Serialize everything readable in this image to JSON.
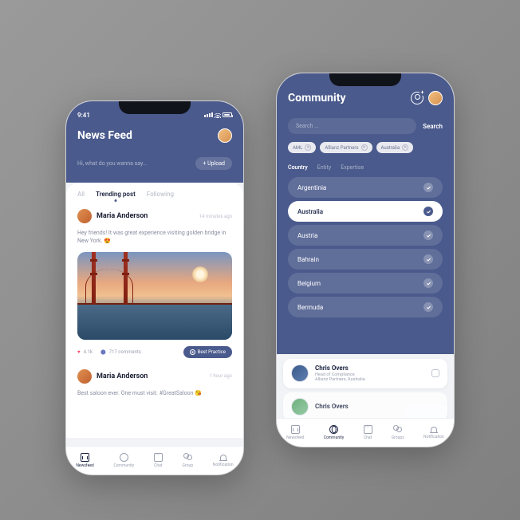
{
  "phone1": {
    "status_time": "9:41",
    "title": "News Feed",
    "say_placeholder": "Hi, what do you wanna say...",
    "upload_label": "+ Upload",
    "tabs": [
      "All",
      "Trending post",
      "Following"
    ],
    "post1": {
      "author": "Maria Anderson",
      "time": "14 minutes ago",
      "body": "Hey friends! It was great experience visiting golden bridge in New York. 😍",
      "likes": "4.1k",
      "comments_icon": "⬤",
      "comments": "717 comments",
      "badge": "Best Practice"
    },
    "post2": {
      "author": "Maria Anderson",
      "time": "1 hour ago",
      "body": "Best saloon ever. One must visit. #GreatSaloon 😘"
    },
    "nav": [
      "Newsfeed",
      "Community",
      "Chat",
      "Group",
      "Notification"
    ]
  },
  "phone2": {
    "title": "Community",
    "search_placeholder": "Search ...",
    "search_btn": "Search",
    "chips": [
      "AML",
      "Allianz Partners",
      "Australia"
    ],
    "filter_tabs": [
      "Country",
      "Entity",
      "Expertise"
    ],
    "countries": [
      "Argentinia",
      "Australia",
      "Austria",
      "Bahrain",
      "Belgium",
      "Bermuda"
    ],
    "selected_country": "Australia",
    "profile1": {
      "name": "Chris Overs",
      "role": "Head of Compliance",
      "org": "Allianz Partners, Australia"
    },
    "profile2": {
      "name": "Chris Overs"
    },
    "nav": [
      "Newsfeed",
      "Community",
      "Chat",
      "Groups",
      "Notification"
    ]
  }
}
